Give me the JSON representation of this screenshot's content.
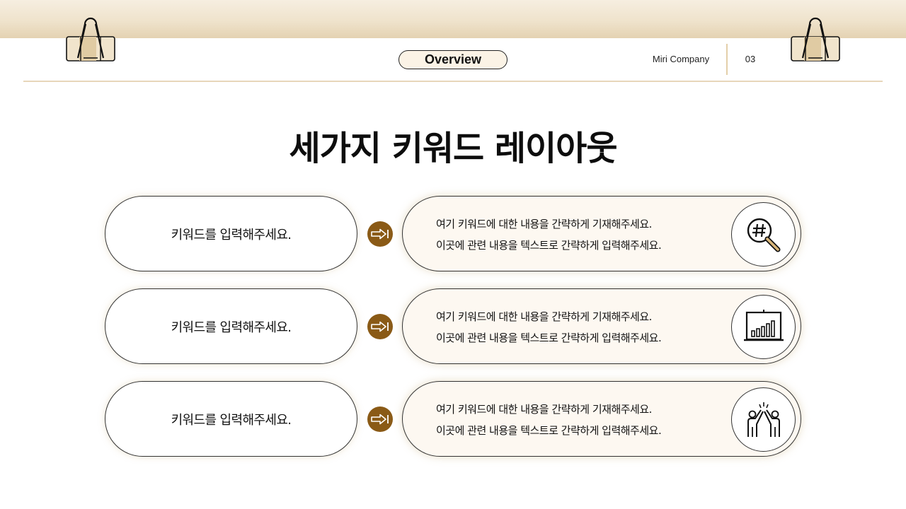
{
  "header": {
    "section_label": "Overview",
    "company": "Miri Company",
    "page_number": "03"
  },
  "title": "세가지 키워드 레이아웃",
  "rows": [
    {
      "keyword": "키워드를 입력해주세요.",
      "line1": "여기 키워드에 대한 내용을 간략하게 기재해주세요.",
      "line2": "이곳에 관련 내용을 텍스트로 간략하게 입력해주세요.",
      "icon": "hashtag-search-icon"
    },
    {
      "keyword": "키워드를 입력해주세요.",
      "line1": "여기 키워드에 대한 내용을 간략하게 기재해주세요.",
      "line2": "이곳에 관련 내용을 텍스트로 간략하게 입력해주세요.",
      "icon": "bar-chart-board-icon"
    },
    {
      "keyword": "키워드를 입력해주세요.",
      "line1": "여기 키워드에 대한 내용을 간략하게 기재해주세요.",
      "line2": "이곳에 관련 내용을 텍스트로 간략하게 입력해주세요.",
      "icon": "high-five-icon"
    }
  ],
  "colors": {
    "accent": "#8a5a16",
    "band": "#efe3cc",
    "pill_fill": "#fdf8f1"
  }
}
